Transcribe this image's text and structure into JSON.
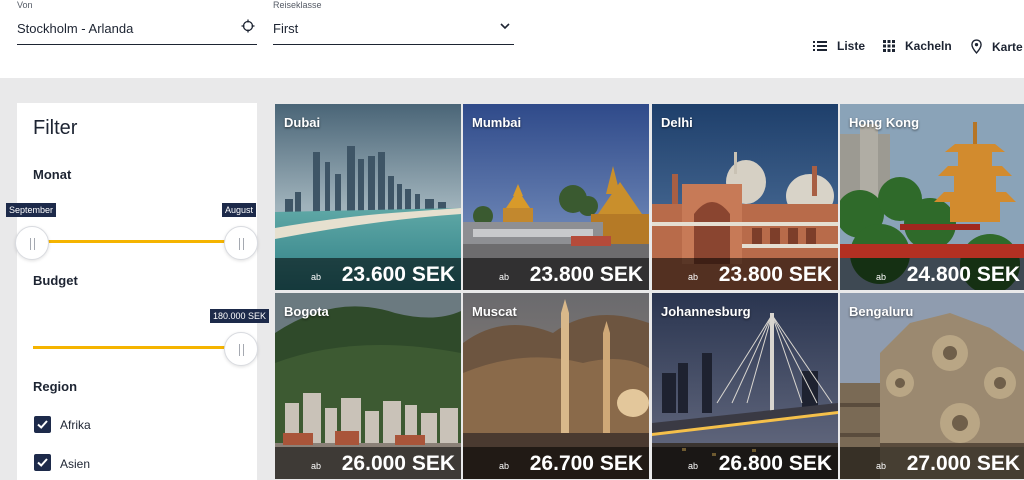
{
  "search": {
    "from_label": "Von",
    "from_value": "Stockholm - Arlanda",
    "class_label": "Reiseklasse",
    "class_value": "First"
  },
  "views": {
    "list": "Liste",
    "tiles": "Kacheln",
    "map": "Karte"
  },
  "filter": {
    "title": "Filter",
    "month": {
      "title": "Monat",
      "start_label": "September",
      "end_label": "August"
    },
    "budget": {
      "title": "Budget",
      "max_label": "180.000 SEK"
    },
    "region": {
      "title": "Region",
      "items": [
        {
          "label": "Afrika",
          "checked": true
        },
        {
          "label": "Asien",
          "checked": true
        }
      ]
    }
  },
  "destinations": [
    {
      "city": "Dubai",
      "prefix": "ab",
      "price": "23.600 SEK"
    },
    {
      "city": "Mumbai",
      "prefix": "ab",
      "price": "23.800 SEK"
    },
    {
      "city": "Delhi",
      "prefix": "ab",
      "price": "23.800 SEK"
    },
    {
      "city": "Hong Kong",
      "prefix": "ab",
      "price": "24.800 SEK"
    },
    {
      "city": "Bogota",
      "prefix": "ab",
      "price": "26.000 SEK"
    },
    {
      "city": "Muscat",
      "prefix": "ab",
      "price": "26.700 SEK"
    },
    {
      "city": "Johannesburg",
      "prefix": "ab",
      "price": "26.800 SEK"
    },
    {
      "city": "Bengaluru",
      "prefix": "ab",
      "price": "27.000 SEK"
    }
  ],
  "colors": {
    "accent": "#f5b400",
    "navy": "#1d2a4a",
    "text": "#1d2432",
    "page_bg": "#e9e9ea"
  }
}
